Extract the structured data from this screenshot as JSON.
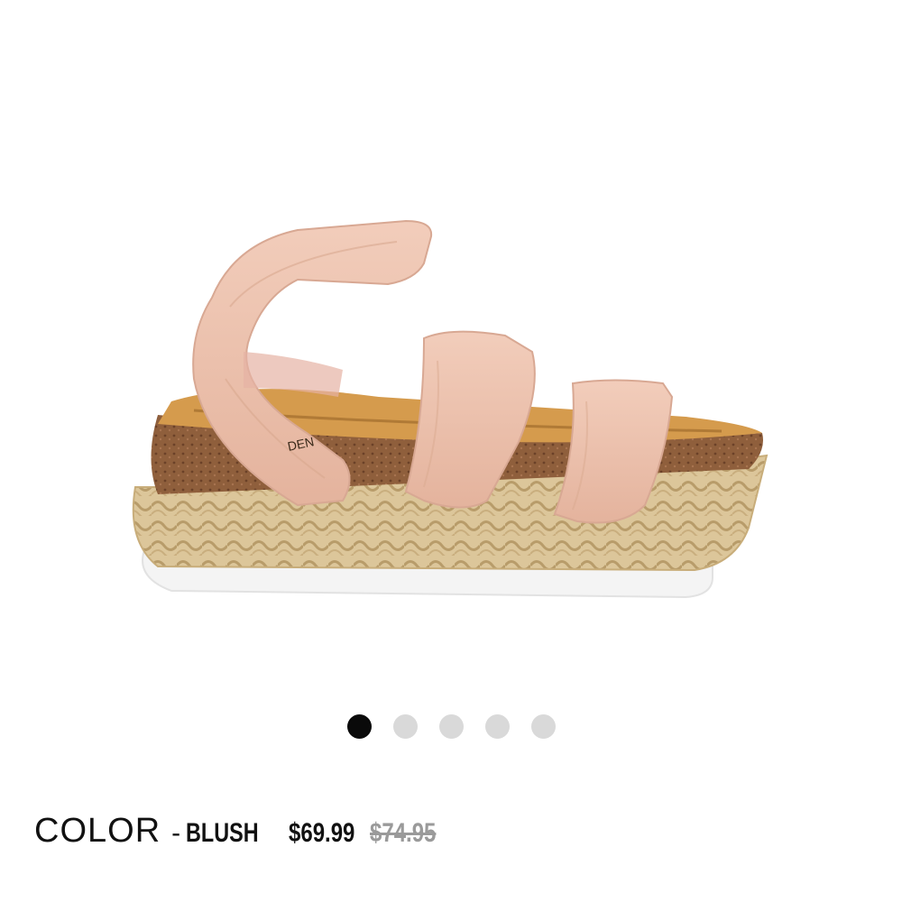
{
  "product": {
    "image_alt": "Blush elastic-strap espadrille platform sandal",
    "brand_imprint": "STEVE MADDEN",
    "colors": {
      "strap": "#ecc2ae",
      "footbed": "#d49a4a",
      "cork": "#8a5a3a",
      "jute": "#d9c397",
      "outsole": "#f5f5f5"
    }
  },
  "carousel": {
    "dots": [
      {
        "active": true
      },
      {
        "active": false
      },
      {
        "active": false
      },
      {
        "active": false
      },
      {
        "active": false
      }
    ],
    "active_color": "#0a0a0a",
    "inactive_color": "#d9d9d9"
  },
  "details": {
    "color_label": "COLOR",
    "separator": "-",
    "color_value": "BLUSH",
    "price_current": "$69.99",
    "price_original": "$74.95"
  }
}
